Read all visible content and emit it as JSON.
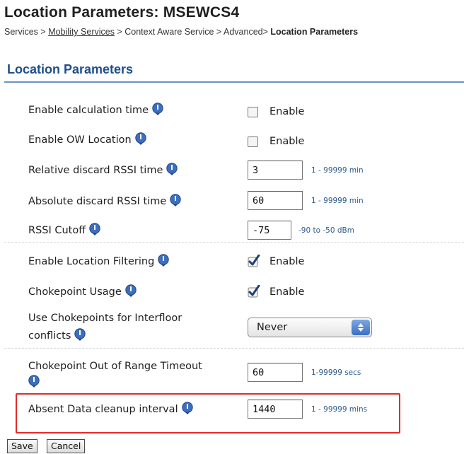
{
  "page": {
    "title": "Location Parameters: MSEWCS4",
    "breadcrumb": {
      "services": "Services",
      "sep1": " > ",
      "mobility": "Mobility Services",
      "sep2": " > ",
      "context_advanced": "Context Aware Service > Advanced> ",
      "current": "Location Parameters"
    }
  },
  "section": {
    "title": "Location Parameters"
  },
  "icons": {
    "info": "info-icon",
    "info_color": "#3d6fbd"
  },
  "colors": {
    "highlight_border": "#e02b2b",
    "section_title": "#1f4e8c",
    "hint": "#2c5b8c"
  },
  "params": {
    "enable_calc_time": {
      "label": "Enable calculation time",
      "checked": false,
      "checkbox_label": "Enable"
    },
    "enable_ow_location": {
      "label": "Enable OW Location",
      "checked": false,
      "checkbox_label": "Enable"
    },
    "relative_discard": {
      "label": "Relative discard RSSI time",
      "value": "3",
      "hint": "1 - 99999 min"
    },
    "absolute_discard": {
      "label": "Absolute discard RSSI time",
      "value": "60",
      "hint": "1 - 99999 min"
    },
    "rssi_cutoff": {
      "label": "RSSI Cutoff",
      "value": "-75",
      "hint": "-90 to -50 dBm"
    },
    "enable_location_filtering": {
      "label": "Enable Location Filtering",
      "checked": true,
      "checkbox_label": "Enable"
    },
    "chokepoint_usage": {
      "label": "Chokepoint Usage",
      "checked": true,
      "checkbox_label": "Enable"
    },
    "use_chokepoints_interfloor": {
      "label_line1": "Use Chokepoints for Interfloor",
      "label_line2": "conflicts",
      "selected": "Never"
    },
    "chokepoint_timeout": {
      "label": "Chokepoint Out of Range Timeout",
      "value": "60",
      "hint": "1-99999 secs"
    },
    "absent_data_cleanup": {
      "label": "Absent Data cleanup interval",
      "value": "1440",
      "hint": "1 - 99999 mins"
    }
  },
  "buttons": {
    "save": "Save",
    "cancel": "Cancel"
  }
}
